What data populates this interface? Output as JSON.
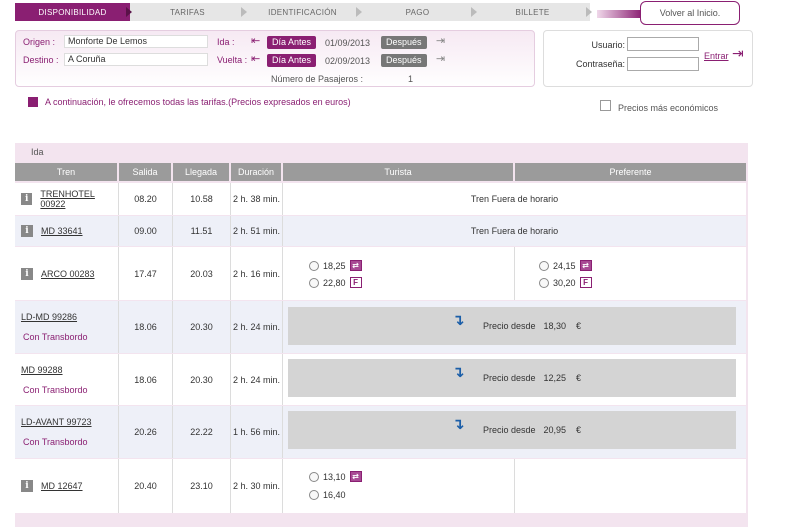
{
  "steps": [
    {
      "label": "DISPONIBILIDAD"
    },
    {
      "label": "TARIFAS"
    },
    {
      "label": "IDENTIFICACIÓN"
    },
    {
      "label": "PAGO"
    },
    {
      "label": "BILLETE"
    }
  ],
  "back_button": "Volver al Inicio.",
  "search": {
    "origin_label": "Origen :",
    "origin_value": "Monforte De Lemos",
    "dest_label": "Destino :",
    "dest_value": "A Coruña",
    "ida_label": "Ida :",
    "vuelta_label": "Vuelta :",
    "prev_label": "Día Antes",
    "next_label": "Después",
    "ida_date": "01/09/2013",
    "vuelta_date": "02/09/2013",
    "passengers_label": "Número de Pasajeros :",
    "passengers_value": "1"
  },
  "login": {
    "user_label": "Usuario:",
    "pass_label": "Contraseña:",
    "enter_label": "Entrar"
  },
  "info_text": "A continuación, le ofrecemos todas las tarifas.(Precios expresados en euros)",
  "cheapest_label": "Precios más económicos",
  "results": {
    "section_label": "Ida",
    "headers": {
      "tren": "Tren",
      "salida": "Salida",
      "llegada": "Llegada",
      "duracion": "Duración",
      "turista": "Turista",
      "preferente": "Preferente"
    },
    "out_of_hours": "Tren Fuera de horario",
    "price_from": "Precio desde",
    "currency": "€",
    "transbordo": "Con Transbordo",
    "rows": [
      {
        "train": "TRENHOTEL 00922",
        "salida": "08.20",
        "llegada": "10.58",
        "duracion": "2 h. 38 min."
      },
      {
        "train": "MD 33641",
        "salida": "09.00",
        "llegada": "11.51",
        "duracion": "2 h. 51 min."
      },
      {
        "train": "ARCO 00283",
        "salida": "17.47",
        "llegada": "20.03",
        "duracion": "2 h. 16 min.",
        "turista": [
          {
            "price": "18,25",
            "badge": "⇄"
          },
          {
            "price": "22,80",
            "badge": "F"
          }
        ],
        "preferente": [
          {
            "price": "24,15",
            "badge": "⇄"
          },
          {
            "price": "30,20",
            "badge": "F"
          }
        ]
      },
      {
        "train": "LD-MD 99286",
        "salida": "18.06",
        "llegada": "20.30",
        "duracion": "2 h. 24 min.",
        "price": "18,30"
      },
      {
        "train": "MD 99288",
        "salida": "18.06",
        "llegada": "20.30",
        "duracion": "2 h. 24 min.",
        "price": "12,25"
      },
      {
        "train": "LD-AVANT 99723",
        "salida": "20.26",
        "llegada": "22.22",
        "duracion": "1 h. 56 min.",
        "price": "20,95"
      },
      {
        "train": "MD 12647",
        "salida": "20.40",
        "llegada": "23.10",
        "duracion": "2 h. 30 min.",
        "turista": [
          {
            "price": "13,10",
            "badge": "⇄"
          },
          {
            "price": "16,40"
          }
        ]
      }
    ]
  },
  "colors": {
    "brand": "#8a1f72",
    "header_grey": "#9b9b9b",
    "price_box": "#d4d4d4",
    "arrow_blue": "#1b5ea8"
  }
}
